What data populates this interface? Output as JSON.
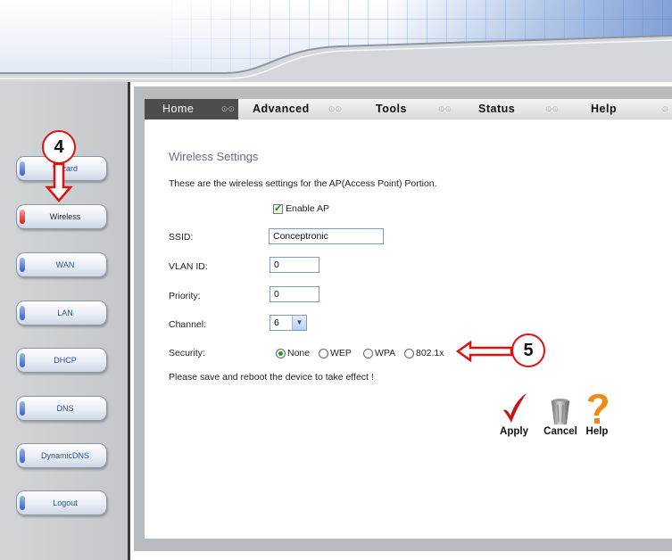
{
  "nav": {
    "items": [
      {
        "label": "Wizard",
        "active": false
      },
      {
        "label": "Wireless",
        "active": true
      },
      {
        "label": "WAN",
        "active": false
      },
      {
        "label": "LAN",
        "active": false
      },
      {
        "label": "DHCP",
        "active": false
      },
      {
        "label": "DNS",
        "active": false
      },
      {
        "label": "DynamicDNS",
        "active": false
      },
      {
        "label": "Logout",
        "active": false
      }
    ]
  },
  "tabs": [
    {
      "label": "Home",
      "active": true
    },
    {
      "label": "Advanced",
      "active": false
    },
    {
      "label": "Tools",
      "active": false
    },
    {
      "label": "Status",
      "active": false
    },
    {
      "label": "Help",
      "active": false
    }
  ],
  "wireless": {
    "title": "Wireless Settings",
    "description": "These are the wireless settings for the AP(Access Point) Portion.",
    "enable_ap_label": "Enable AP",
    "enable_ap_checked": true,
    "ssid_label": "SSID:",
    "ssid_value": "Conceptronic",
    "vlan_label": "VLAN ID:",
    "vlan_value": "0",
    "priority_label": "Priority:",
    "priority_value": "0",
    "channel_label": "Channel:",
    "channel_value": "6",
    "security_label": "Security:",
    "security_options": [
      {
        "label": "None",
        "selected": true
      },
      {
        "label": "WEP",
        "selected": false
      },
      {
        "label": "WPA",
        "selected": false
      },
      {
        "label": "802.1x",
        "selected": false
      }
    ],
    "note": "Please save and reboot the device to take effect !"
  },
  "actions": {
    "apply_label": "Apply",
    "cancel_label": "Cancel",
    "help_label": "Help"
  },
  "callouts": {
    "step4": "4",
    "step5": "5"
  },
  "colors": {
    "callout_red": "#e01010",
    "title_color": "#6b6d8c",
    "active_led": "#d21c1c",
    "radio_selected": "#1a9d1a"
  }
}
